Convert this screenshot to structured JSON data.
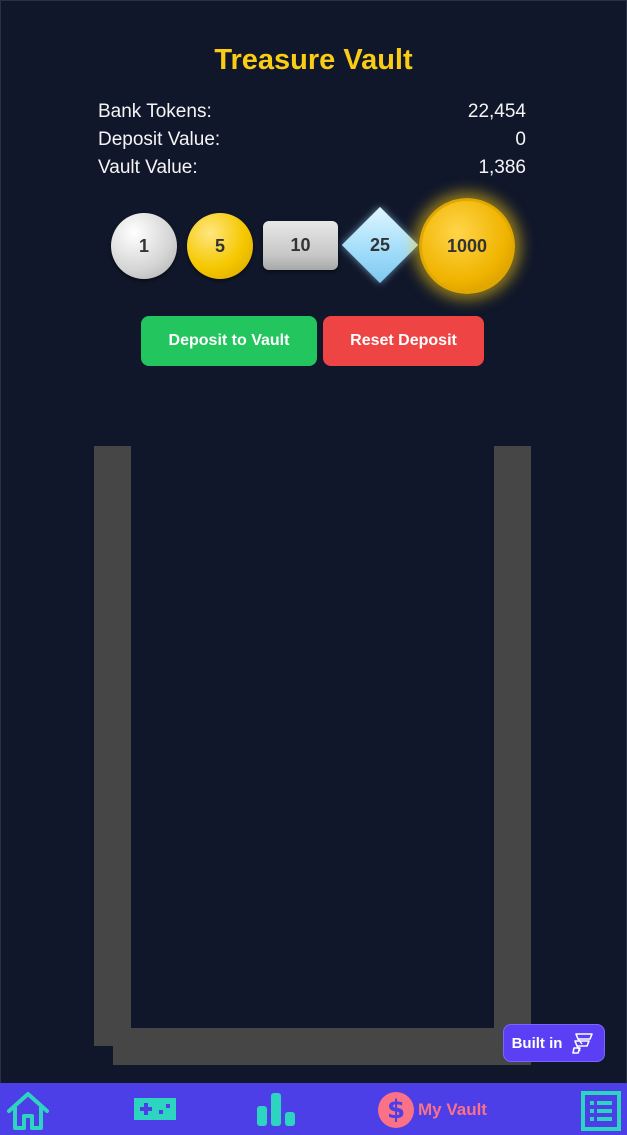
{
  "game": {
    "title": "Treasure Vault"
  },
  "stats": [
    {
      "label": "Bank Tokens:",
      "value": "22,454"
    },
    {
      "label": "Deposit Value:",
      "value": "0"
    },
    {
      "label": "Vault Value:",
      "value": "1,386"
    }
  ],
  "chips": [
    {
      "label": "1",
      "shape": "circle",
      "color": "#d4d4d4"
    },
    {
      "label": "5",
      "shape": "circle",
      "color": "#f5c800"
    },
    {
      "label": "10",
      "shape": "rounded-rect",
      "color": "#c6c6c6"
    },
    {
      "label": "25",
      "shape": "diamond",
      "color": "#9fdcfb"
    },
    {
      "label": "1000",
      "shape": "glowing-circle",
      "color": "#f0b400"
    }
  ],
  "buttons": {
    "deposit_label": "Deposit to Vault",
    "reset_label": "Reset Deposit"
  },
  "badge": {
    "label": "Built in",
    "icon": "builder-logo-icon"
  },
  "nav": {
    "items": [
      {
        "icon": "home-icon"
      },
      {
        "icon": "gamepad-icon"
      },
      {
        "icon": "bar-chart-icon"
      },
      {
        "icon": "dollar-coin-icon",
        "label": "My Vault",
        "symbol": "$"
      },
      {
        "icon": "list-icon"
      }
    ]
  },
  "colors": {
    "background": "#10172a",
    "title": "#facc15",
    "deposit_button": "#22c55e",
    "reset_button": "#ef4444",
    "vault_walls": "#464646",
    "nav_bar": "#4c3fe8",
    "nav_icons": "#2dd4bf",
    "active_nav": "#fb7185"
  }
}
